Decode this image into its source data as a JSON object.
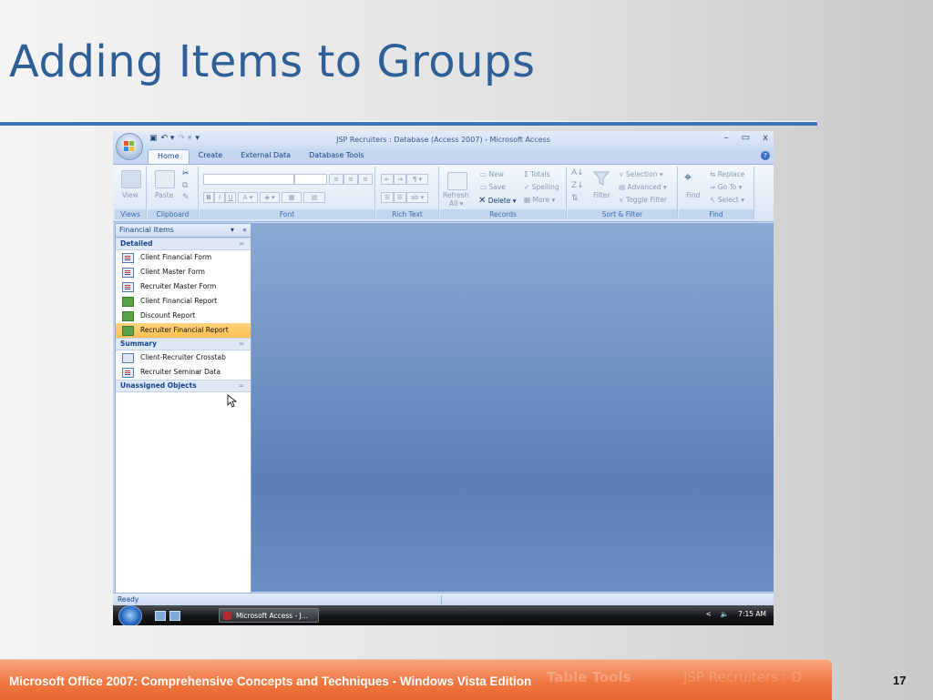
{
  "slide": {
    "title": "Adding Items to Groups",
    "footer": "Microsoft Office 2007: Comprehensive Concepts and Techniques - Windows Vista Edition",
    "page_number": "17",
    "footer_ghost_left": "Table Tools",
    "footer_ghost_right": "JSP Recruiters : D"
  },
  "window": {
    "title": "JSP Recruiters : Database (Access 2007) - Microsoft Access",
    "controls": [
      "–",
      "▭",
      "x"
    ],
    "help": "?"
  },
  "tabs": [
    {
      "label": "Home",
      "active": true
    },
    {
      "label": "Create"
    },
    {
      "label": "External Data"
    },
    {
      "label": "Database Tools"
    }
  ],
  "ribbon": {
    "views": {
      "label": "Views",
      "button": "View"
    },
    "clipboard": {
      "label": "Clipboard",
      "paste": "Paste"
    },
    "font": {
      "label": "Font"
    },
    "rich_text": {
      "label": "Rich Text"
    },
    "records": {
      "label": "Records",
      "refresh": "Refresh",
      "refresh_sub": "All ▾",
      "new": "New",
      "save": "Save",
      "delete": "Delete ▾",
      "totals": "Totals",
      "spelling": "Spelling",
      "more": "More ▾"
    },
    "sort_filter": {
      "label": "Sort & Filter",
      "filter": "Filter",
      "selection": "Selection ▾",
      "advanced": "Advanced ▾",
      "toggle": "Toggle Filter"
    },
    "find": {
      "label": "Find",
      "find": "Find",
      "replace": "Replace",
      "goto": "Go To ▾",
      "select": "Select ▾"
    }
  },
  "nav_pane": {
    "header": "Financial Items",
    "groups": [
      {
        "name": "Detailed",
        "items": [
          {
            "label": "Client Financial Form",
            "type": "form"
          },
          {
            "label": "Client Master Form",
            "type": "form"
          },
          {
            "label": "Recruiter Master Form",
            "type": "form"
          },
          {
            "label": "Client Financial Report",
            "type": "report"
          },
          {
            "label": "Discount Report",
            "type": "report"
          },
          {
            "label": "Recruiter Financial Report",
            "type": "report",
            "selected": true
          }
        ]
      },
      {
        "name": "Summary",
        "items": [
          {
            "label": "Client-Recruiter Crosstab",
            "type": "query"
          },
          {
            "label": "Recruiter Seminar Data",
            "type": "form"
          }
        ]
      },
      {
        "name": "Unassigned Objects",
        "items": []
      }
    ]
  },
  "status": {
    "text": "Ready"
  },
  "taskbar": {
    "button": "Microsoft Access - J...",
    "time": "7:15 AM",
    "tray_arrow": "<"
  }
}
